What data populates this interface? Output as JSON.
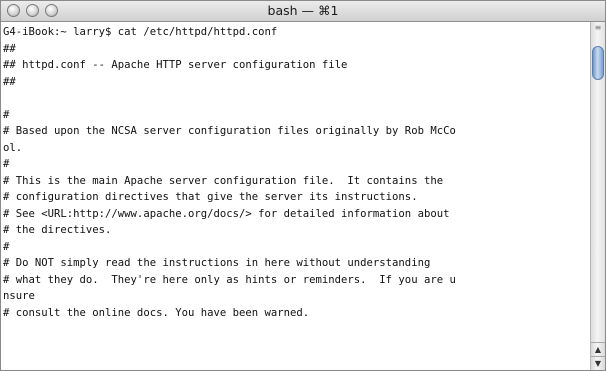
{
  "window": {
    "title": "bash — ⌘1"
  },
  "terminal": {
    "lines": [
      "G4-iBook:~ larry$ cat /etc/httpd/httpd.conf",
      "##",
      "## httpd.conf -- Apache HTTP server configuration file",
      "##",
      "",
      "#",
      "# Based upon the NCSA server configuration files originally by Rob McCo",
      "ol.",
      "#",
      "# This is the main Apache server configuration file.  It contains the",
      "# configuration directives that give the server its instructions.",
      "# See <URL:http://www.apache.org/docs/> for detailed information about",
      "# the directives.",
      "#",
      "# Do NOT simply read the instructions in here without understanding",
      "# what they do.  They're here only as hints or reminders.  If you are u",
      "nsure",
      "# consult the online docs. You have been warned."
    ]
  },
  "scrollbar": {
    "grip_icon": "resize-grip-icon",
    "up_glyph": "▲",
    "down_glyph": "▼",
    "position_fraction": 0.05
  },
  "colors": {
    "thumb_accent": "#7aa1d2",
    "text": "#111111",
    "background": "#ffffff"
  }
}
